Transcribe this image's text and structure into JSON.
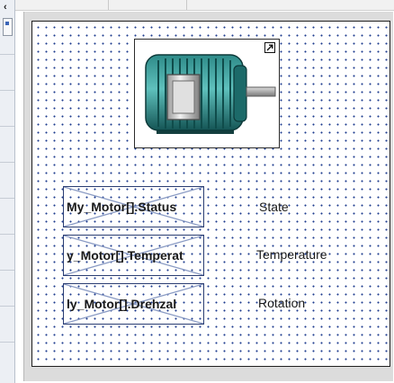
{
  "toolbar": {
    "collapse_icon": "collapse-left-icon"
  },
  "canvas": {
    "motor_object": {
      "icon": "motor-icon",
      "expand_icon": "expand-arrow-icon",
      "colors": {
        "body": "#1f6f6e",
        "fins": "#49a7a4",
        "cover": "#c9c9c9",
        "shaft": "#9c9c9c"
      }
    },
    "tags": [
      {
        "text": "My_Motor[].Status",
        "align": "left"
      },
      {
        "text": "y_Motor[].Temperat",
        "align": "left"
      },
      {
        "text": "ly_Motor[].Drehzal",
        "align": "left"
      }
    ],
    "labels": [
      {
        "text": "State"
      },
      {
        "text": "Temperature"
      },
      {
        "text": "Rotation"
      }
    ]
  }
}
